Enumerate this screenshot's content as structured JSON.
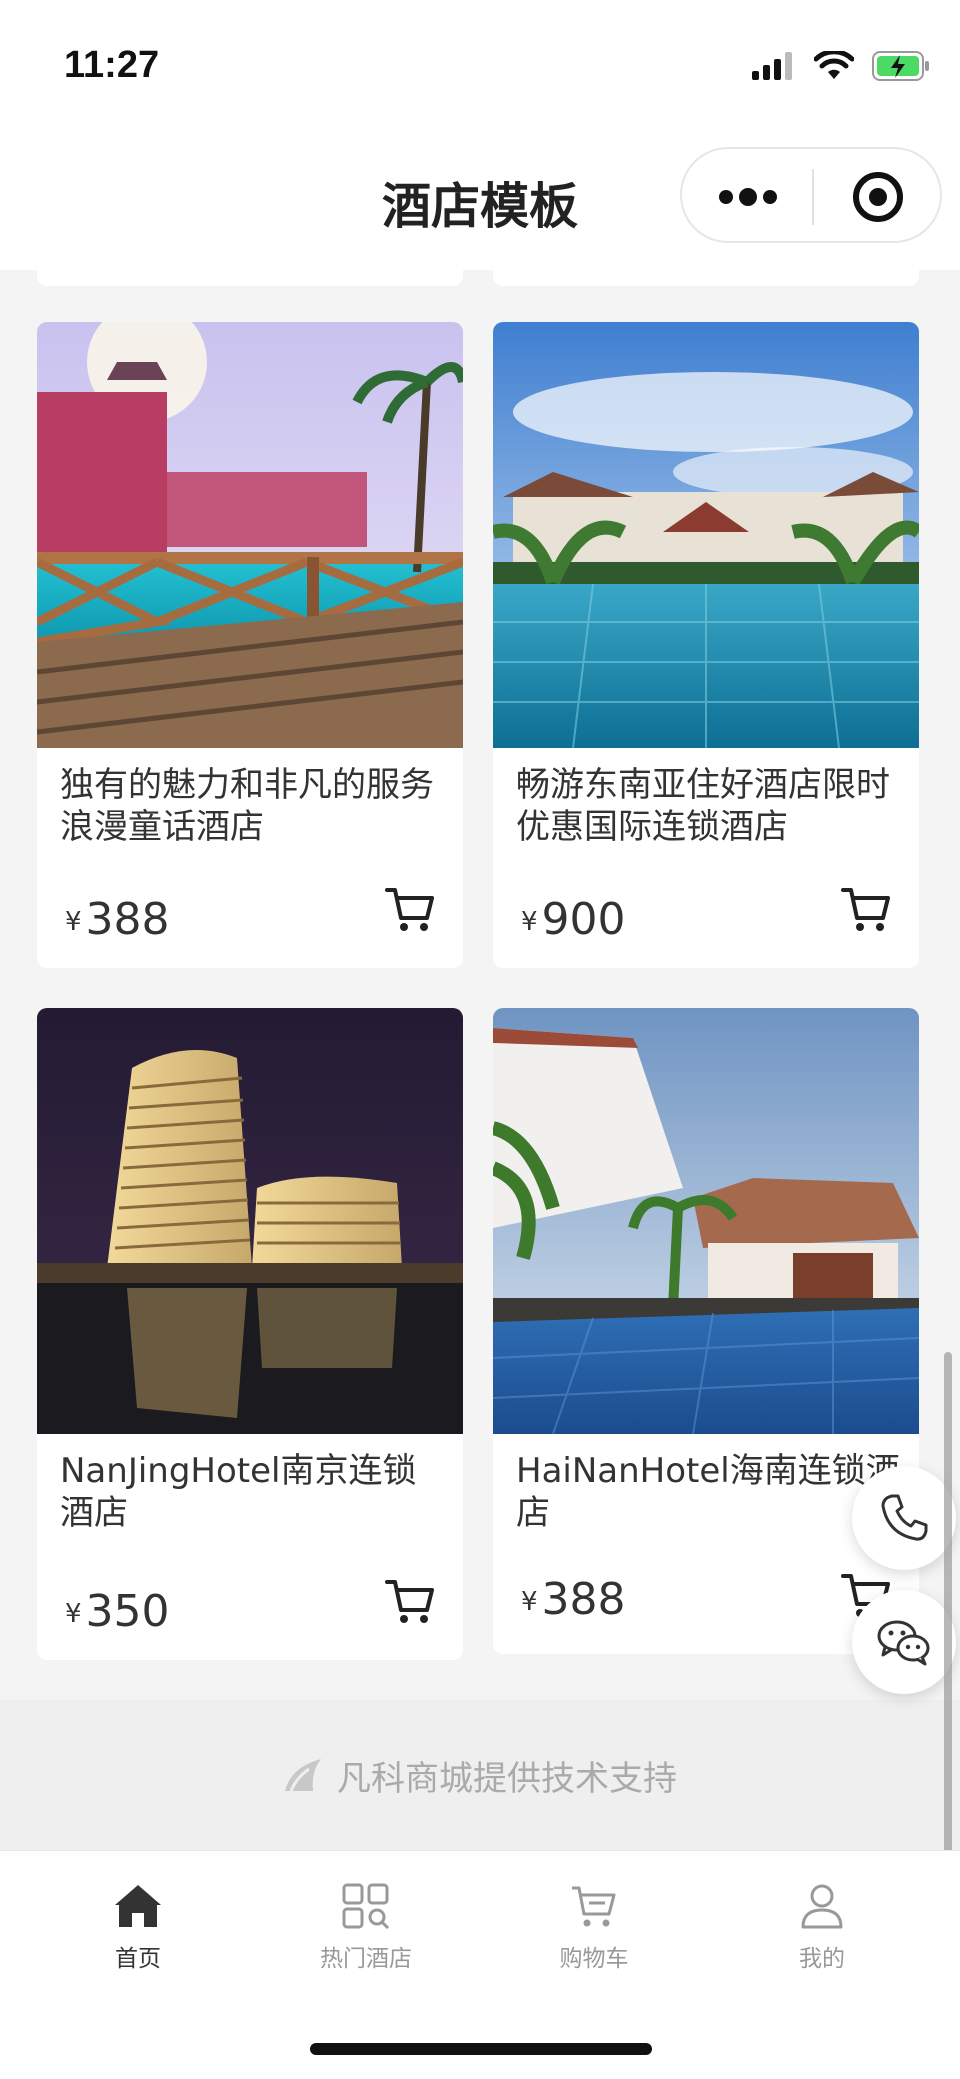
{
  "status_bar": {
    "time": "11:27"
  },
  "header": {
    "title": "酒店模板"
  },
  "hotels": [
    {
      "name": "独有的魅力和非凡的服务浪漫童话酒店",
      "currency": "¥",
      "price": "388",
      "image": "pink-resort-pool-photo"
    },
    {
      "name": "畅游东南亚住好酒店限时优惠国际连锁酒店",
      "currency": "¥",
      "price": "900",
      "image": "tropical-resort-pool-photo"
    },
    {
      "name": "NanJingHotel南京连锁酒店",
      "currency": "¥",
      "price": "350",
      "image": "night-hotel-tower-photo"
    },
    {
      "name": "HaiNanHotel海南连锁酒店",
      "currency": "¥",
      "price": "388",
      "image": "villa-pool-photo"
    }
  ],
  "footer": {
    "brand_text": "凡科商城提供技术支持"
  },
  "tabbar": {
    "items": [
      {
        "label": "首页",
        "icon": "home-icon",
        "active": true
      },
      {
        "label": "热门酒店",
        "icon": "grid-search-icon",
        "active": false
      },
      {
        "label": "购物车",
        "icon": "cart-icon",
        "active": false
      },
      {
        "label": "我的",
        "icon": "user-icon",
        "active": false
      }
    ]
  },
  "floating": {
    "phone_icon": "phone-icon",
    "wechat_icon": "wechat-icon"
  },
  "colors": {
    "active_tab": "#333333",
    "inactive_tab": "#999999",
    "page_bg": "#f4f4f4"
  }
}
